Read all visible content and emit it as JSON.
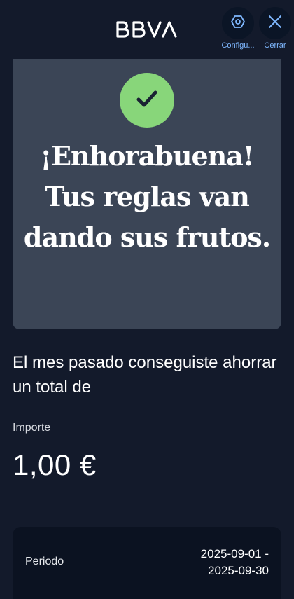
{
  "header": {
    "brand": "BBVA",
    "settings_label": "Configu...",
    "close_label": "Cerrar"
  },
  "hero": {
    "title": "¡Enhorabuena! Tus reglas van dando sus frutos.",
    "accent_color": "#88d67a"
  },
  "summary": {
    "text": "El mes pasado conseguiste ahorrar un total de",
    "amount_label": "Importe",
    "amount_value": "1,00 €"
  },
  "period": {
    "label": "Periodo",
    "start": "2025-09-01 -",
    "end": "2025-09-30"
  },
  "icons": {
    "settings": "hexagon-gear-icon",
    "close": "close-icon",
    "success": "checkmark-icon"
  }
}
